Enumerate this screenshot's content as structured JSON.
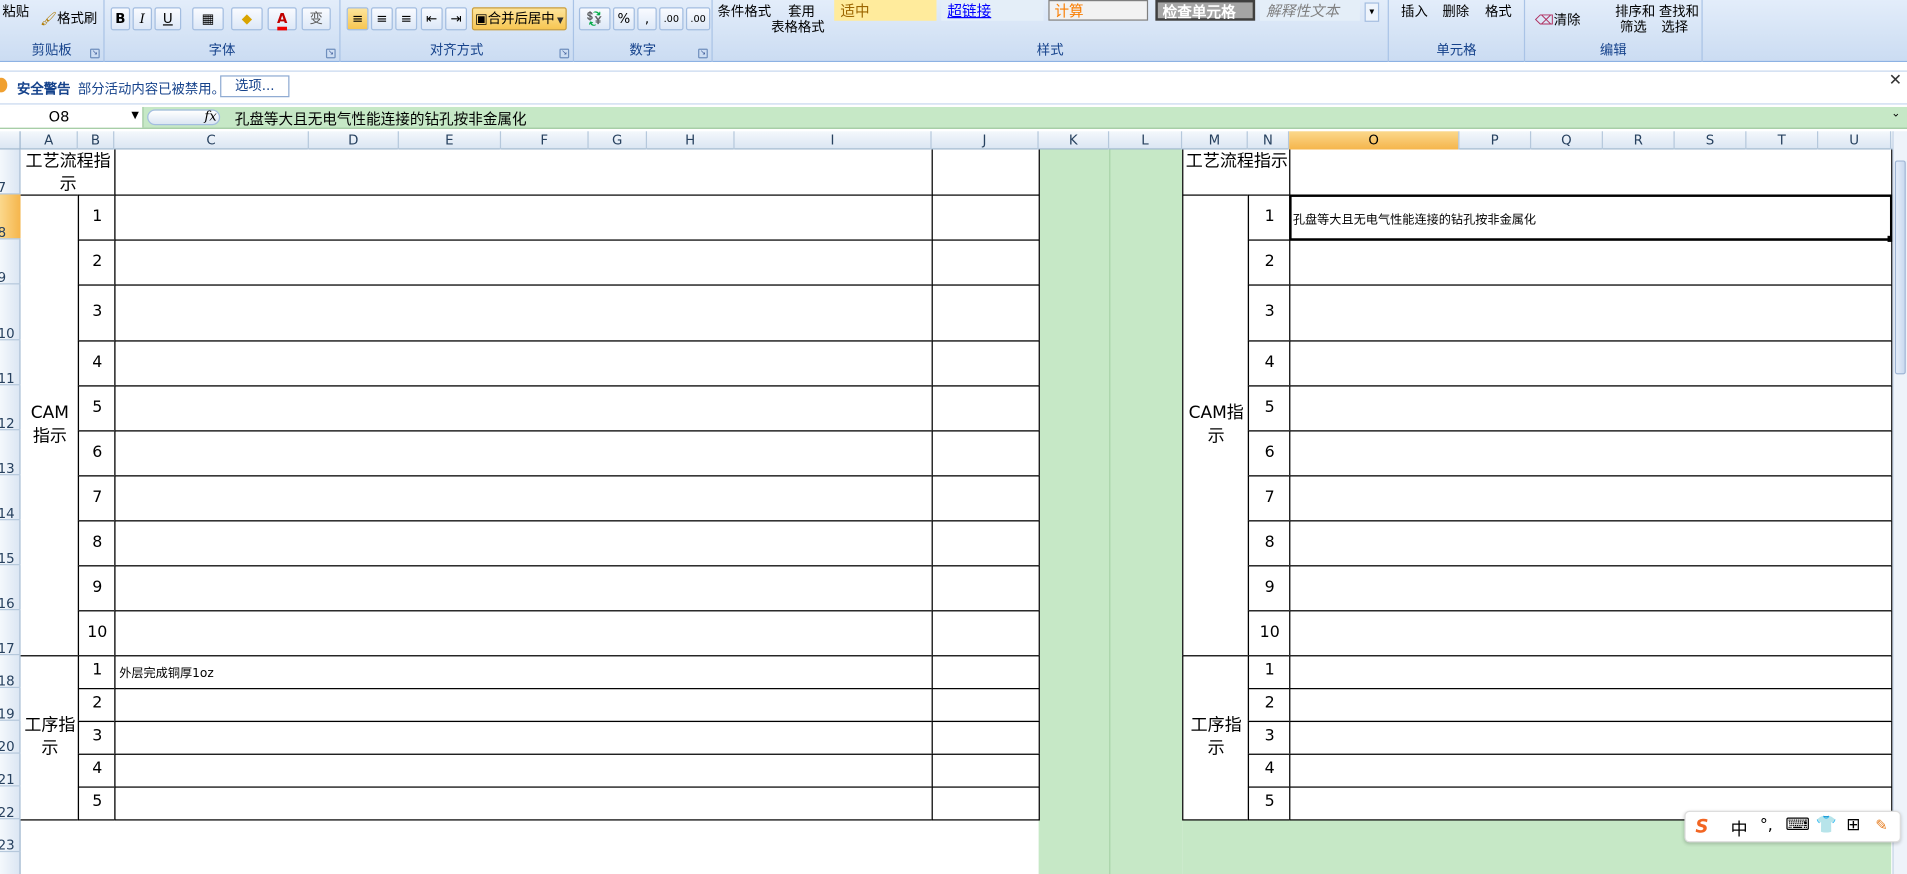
{
  "ribbon": {
    "clipboard": {
      "paste": "粘贴",
      "format_painter": "格式刷",
      "label": "剪贴板"
    },
    "font": {
      "bold": "B",
      "italic": "I",
      "underline": "U",
      "font_color": "A",
      "phonetic": "变",
      "label": "字体"
    },
    "alignment": {
      "merge_center": "合并后居中",
      "label": "对齐方式"
    },
    "number": {
      "percent": "%",
      "comma": ",",
      "inc_decimal": ".00",
      "dec_decimal": ".00",
      "label": "数字"
    },
    "styles": {
      "conditional": "条件格式",
      "table_format_1": "套用",
      "table_format_2": "表格格式",
      "style_neutral": "适中",
      "style_hyperlink": "超链接",
      "style_calc": "计算",
      "style_check": "检查单元格",
      "style_explanatory": "解释性文本",
      "label": "样式"
    },
    "cells": {
      "insert": "插入",
      "delete": "删除",
      "format": "格式",
      "label": "单元格"
    },
    "editing": {
      "clear": "清除",
      "sort_1": "排序和",
      "sort_2": "筛选",
      "find_1": "查找和",
      "find_2": "选择",
      "label": "编辑"
    }
  },
  "security": {
    "title": "安全警告",
    "message": "部分活动内容已被禁用。",
    "options_button": "选项..."
  },
  "formula_bar": {
    "name_box": "O8",
    "fx": "fx",
    "content": "孔盘等大且无电气性能连接的钻孔按非金属化"
  },
  "columns": [
    "A",
    "B",
    "C",
    "D",
    "E",
    "F",
    "G",
    "H",
    "I",
    "J",
    "K",
    "L",
    "M",
    "N",
    "O",
    "P",
    "Q",
    "R",
    "S",
    "T",
    "U"
  ],
  "selected_column": "O",
  "rows": [
    "7",
    "8",
    "9",
    "10",
    "11",
    "12",
    "13",
    "14",
    "15",
    "16",
    "17",
    "18",
    "19",
    "20",
    "21",
    "22",
    "23"
  ],
  "selected_row": "8",
  "sheet": {
    "process_label": "工艺流程指示",
    "cam_label": "CAM指示",
    "step_label": "工序指示",
    "cam_numbers": [
      "1",
      "2",
      "3",
      "4",
      "5",
      "6",
      "7",
      "8",
      "9",
      "10"
    ],
    "step_numbers": [
      "1",
      "2",
      "3",
      "4",
      "5"
    ],
    "left_step1_text": "外层完成铜厚1oz",
    "right_cam1_text": "孔盘等大且无电气性能连接的钻孔按非金属化"
  },
  "ime": {
    "s": "S",
    "zh": "中",
    "punct": "°,"
  }
}
